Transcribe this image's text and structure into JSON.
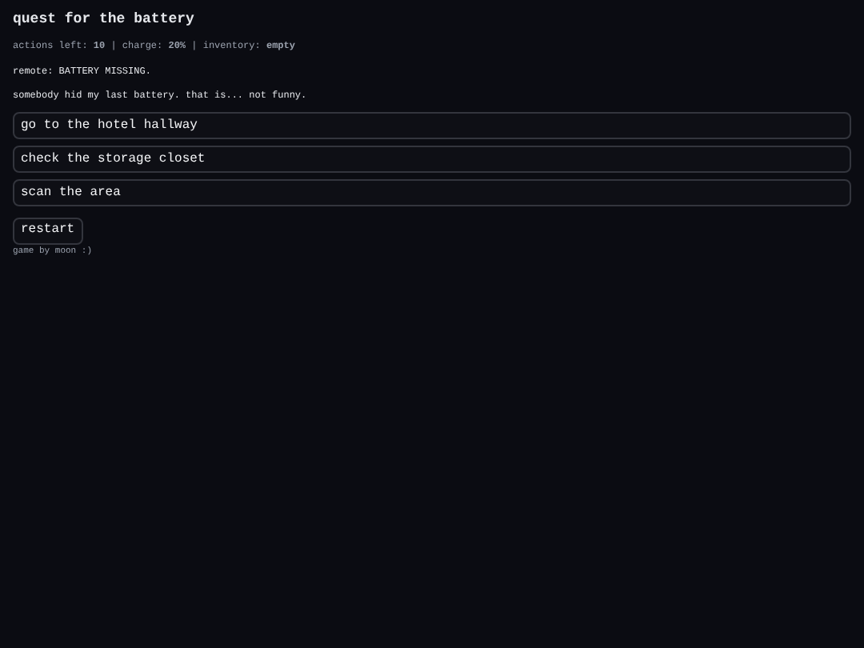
{
  "title": "quest for the battery",
  "status": "actions left: **10** | charge: **20%** | inventory: **empty**",
  "messages": [
    "remote: BATTERY MISSING.",
    "somebody hid my last battery. that is... not funny."
  ],
  "choices": [
    "go to the hotel hallway",
    "check the storage closet",
    "scan the area"
  ],
  "restart": "restart",
  "footer": "game by moon :)"
}
